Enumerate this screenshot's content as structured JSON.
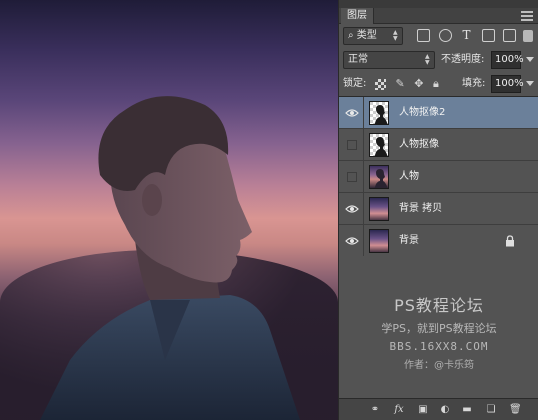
{
  "panel": {
    "tab_title": "图层",
    "filter": {
      "selected": "类型",
      "icon": "search-icon"
    },
    "filter_icons": [
      "image-filter-icon",
      "adjustment-filter-icon",
      "type-filter-icon",
      "shape-filter-icon",
      "smart-object-filter-icon"
    ],
    "blend_mode": "正常",
    "opacity_label": "不透明度:",
    "opacity_value": "100%",
    "lock_label": "锁定:",
    "fill_label": "填充:",
    "fill_value": "100%"
  },
  "layers": [
    {
      "name": "人物抠像2",
      "visible": true,
      "selected": true,
      "thumb": "cutout"
    },
    {
      "name": "人物抠像",
      "visible": false,
      "selected": false,
      "thumb": "cutout"
    },
    {
      "name": "人物",
      "visible": false,
      "selected": false,
      "thumb": "photo"
    },
    {
      "name": "背景 拷贝",
      "visible": true,
      "selected": false,
      "thumb": "sky"
    },
    {
      "name": "背景",
      "visible": true,
      "selected": false,
      "thumb": "sky",
      "locked": true
    }
  ],
  "watermark": {
    "title": "PS教程论坛",
    "subtitle": "学PS，就到PS教程论坛",
    "url": "BBS.16XX8.COM",
    "author": "作者：@卡乐筠"
  },
  "bottom_toolbar": [
    "link-layers-icon",
    "fx-icon",
    "add-mask-icon",
    "adjustment-layer-icon",
    "new-group-icon",
    "new-layer-icon",
    "delete-icon"
  ],
  "colors": {
    "panel_bg": "#535353",
    "selected_layer": "#6b809a"
  }
}
